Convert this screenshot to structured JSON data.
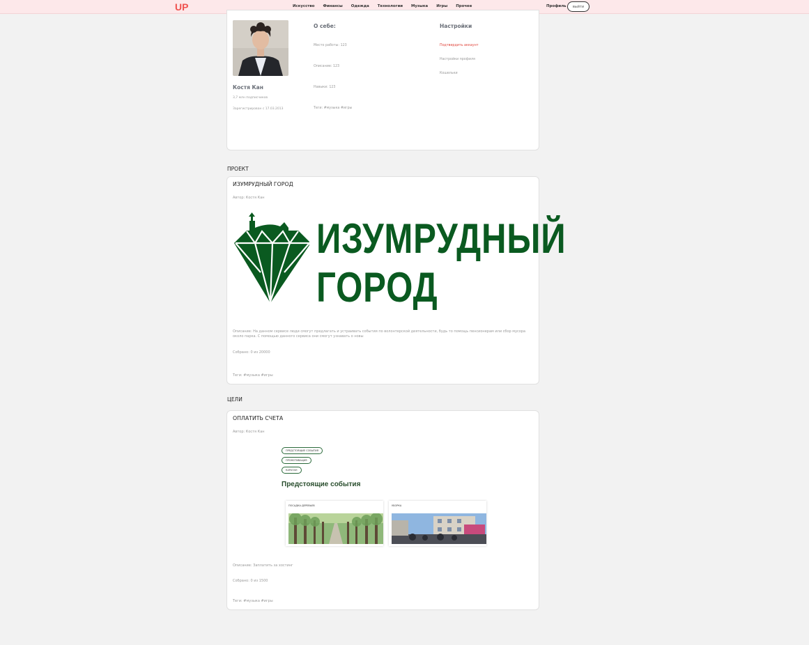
{
  "header": {
    "logo_text": "UP",
    "nav": [
      "Искусство",
      "Финансы",
      "Одежда",
      "Технологии",
      "Музыка",
      "Игры",
      "Прочее"
    ],
    "profile_link": "Профиль",
    "logout_label": "выйти"
  },
  "profile": {
    "name": "Костя Кан",
    "followers": "3,7 млн подписчиков",
    "registered": "Зарегистрирован с 17.03.2013",
    "about_title": "О себе:",
    "about": [
      "Место работы: 123",
      "Описание: 123",
      "Навыки: 123",
      "Теги: #музыка #игры"
    ],
    "settings_title": "Настройки",
    "settings": [
      "Подтвердить аккаунт",
      "Настройки профиля",
      "Кошельки"
    ]
  },
  "project_section": {
    "label": "ПРОЕКТ",
    "title": "ИЗУМРУДНЫЙ ГОРОД",
    "author": "Автор: Костя Кан",
    "logo_line1": "ИЗУМРУДНЫЙ",
    "logo_line2": "ГОРОД",
    "description": "Описание: На данном сервисе люди смогут предлагать и устраивать события по волонтерской деятельности, будь то помощь пенсионерам или сбор мусора около парка. С помощью данного сервиса они смогут узнавать о новы",
    "collected": "Собрано: 0 из 20000",
    "tags": "Теги: #музыка #игры"
  },
  "goals_section": {
    "label": "ЦЕЛИ",
    "title": "ОПЛАТИТЬ СЧЕТА",
    "author": "Автор: Костя Кан",
    "pills": [
      "ПРЕДСТОЯЩИЕ СОБЫТИЯ",
      "ПРОМОТИВАЦИЯ",
      "КАРАТАН"
    ],
    "shot_heading": "Предстоящие события",
    "event_labels": [
      "ПОСАДКА ДЕРЕВЬЕВ",
      "УБОРКА"
    ],
    "description": "Описание: Заплатить за хостинг",
    "collected": "Собрано: 0 из 1500",
    "tags": "Теги: #музыка #игры"
  },
  "colors": {
    "brand": "#f0524f",
    "emerald": "#0a5a20",
    "danger": "#e0463c",
    "header_bg": "#fde8ea"
  }
}
